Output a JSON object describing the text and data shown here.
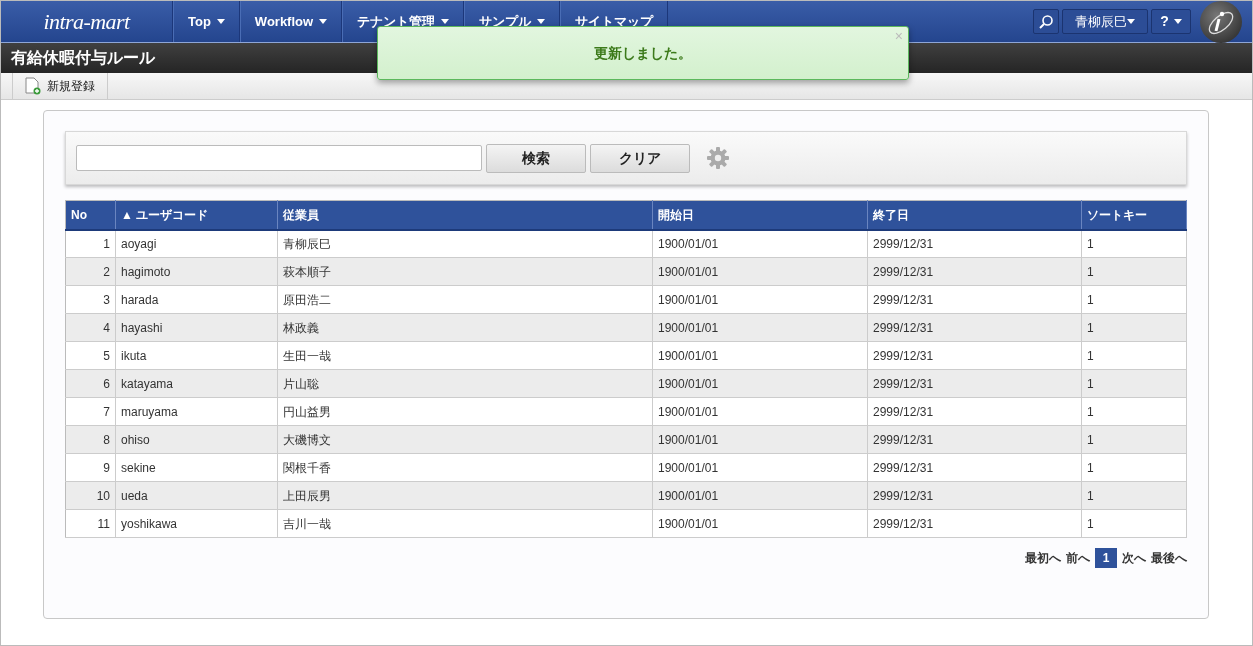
{
  "header": {
    "logo": "intra-mart",
    "nav": [
      {
        "label": "Top",
        "kind": "dropdown"
      },
      {
        "label": "Workflow",
        "kind": "dropdown"
      },
      {
        "label": "テナント管理",
        "kind": "dropdown"
      },
      {
        "label": "サンプル",
        "kind": "dropdown"
      },
      {
        "label": "サイトマップ",
        "kind": "link"
      }
    ],
    "user": "青柳辰巳",
    "help": "?"
  },
  "toast": {
    "message": "更新しました。",
    "close": "×"
  },
  "page_title": "有給休暇付与ルール",
  "toolbar": [
    {
      "label": "新規登録"
    }
  ],
  "search": {
    "buttons": [
      "検索",
      "クリア"
    ]
  },
  "table": {
    "columns": [
      {
        "label": "No"
      },
      {
        "label": "ユーザコード",
        "sort_indicator": "▲"
      },
      {
        "label": "従業員"
      },
      {
        "label": "開始日"
      },
      {
        "label": "終了日"
      },
      {
        "label": "ソートキー"
      }
    ],
    "rows": [
      [
        "1",
        "aoyagi",
        "青柳辰巳",
        "1900/01/01",
        "2999/12/31",
        "1"
      ],
      [
        "2",
        "hagimoto",
        "萩本順子",
        "1900/01/01",
        "2999/12/31",
        "1"
      ],
      [
        "3",
        "harada",
        "原田浩二",
        "1900/01/01",
        "2999/12/31",
        "1"
      ],
      [
        "4",
        "hayashi",
        "林政義",
        "1900/01/01",
        "2999/12/31",
        "1"
      ],
      [
        "5",
        "ikuta",
        "生田一哉",
        "1900/01/01",
        "2999/12/31",
        "1"
      ],
      [
        "6",
        "katayama",
        "片山聡",
        "1900/01/01",
        "2999/12/31",
        "1"
      ],
      [
        "7",
        "maruyama",
        "円山益男",
        "1900/01/01",
        "2999/12/31",
        "1"
      ],
      [
        "8",
        "ohiso",
        "大磯博文",
        "1900/01/01",
        "2999/12/31",
        "1"
      ],
      [
        "9",
        "sekine",
        "関根千香",
        "1900/01/01",
        "2999/12/31",
        "1"
      ],
      [
        "10",
        "ueda",
        "上田辰男",
        "1900/01/01",
        "2999/12/31",
        "1"
      ],
      [
        "11",
        "yoshikawa",
        "吉川一哉",
        "1900/01/01",
        "2999/12/31",
        "1"
      ]
    ]
  },
  "pager": {
    "first": "最初へ",
    "prev": "前へ",
    "pages": [
      {
        "label": "1",
        "selected": true
      }
    ],
    "next": "次へ",
    "last": "最後へ"
  }
}
